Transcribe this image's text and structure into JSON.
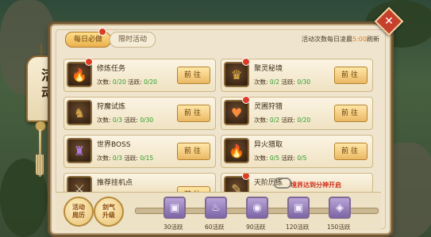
{
  "side_banner": {
    "title": "活动"
  },
  "tabs": [
    {
      "label": "每日必做",
      "active": true
    },
    {
      "label": "限时活动",
      "active": false
    }
  ],
  "refresh_note": {
    "prefix": "活动次数每日凌晨",
    "time": "5:00",
    "suffix": "刷新"
  },
  "tasks": [
    {
      "name": "修炼任务",
      "count_label": "次数:",
      "count": "0/20",
      "activity_label": "活跃:",
      "activity": "0/20",
      "button": "前往",
      "icon": "fire-icon",
      "badge": true
    },
    {
      "name": "聚灵秘境",
      "count_label": "次数:",
      "count": "0/2",
      "activity_label": "活跃:",
      "activity": "0/30",
      "button": "前往",
      "icon": "beast-mask-icon",
      "badge": true
    },
    {
      "name": "狩魔试炼",
      "count_label": "次数:",
      "count": "0/3",
      "activity_label": "活跃:",
      "activity": "0/30",
      "button": "前往",
      "icon": "demon-warrior-icon",
      "badge": false
    },
    {
      "name": "灵圃狩猎",
      "count_label": "次数:",
      "count": "0/2",
      "activity_label": "活跃:",
      "activity": "0/20",
      "button": "前往",
      "icon": "fox-spirit-icon",
      "badge": true
    },
    {
      "name": "世界BOSS",
      "count_label": "次数:",
      "count": "0/3",
      "activity_label": "活跃:",
      "activity": "0/15",
      "button": "前往",
      "icon": "boss-icon",
      "badge": false
    },
    {
      "name": "异火猎取",
      "count_label": "次数:",
      "count": "0/5",
      "activity_label": "活跃:",
      "activity": "0/5",
      "button": "前往",
      "icon": "blue-flame-icon",
      "badge": false
    },
    {
      "name": "推荐挂机点",
      "button": "前往",
      "icon": "sword-icon",
      "badge": false
    },
    {
      "name": "天阶历练",
      "icon": "scroll-icon",
      "badge": true
    }
  ],
  "unlock_note": "境界达到分神开启",
  "bottom_buttons": [
    {
      "label": "活动周历",
      "icon": "calendar-icon"
    },
    {
      "label": "剑气升级",
      "icon": "sword-upgrade-icon"
    }
  ],
  "activity_rewards": [
    {
      "label": "30活跃",
      "icon": "card-chest-icon"
    },
    {
      "label": "60活跃",
      "icon": "dragon-chest-icon"
    },
    {
      "label": "90活跃",
      "icon": "orb-chest-icon"
    },
    {
      "label": "120活跃",
      "icon": "card-chest-icon"
    },
    {
      "label": "150活跃",
      "icon": "crystal-chest-icon"
    }
  ],
  "colors": {
    "accent_orange": "#e07a14",
    "progress_green": "#2e9a28",
    "alert_red": "#d3301e"
  }
}
